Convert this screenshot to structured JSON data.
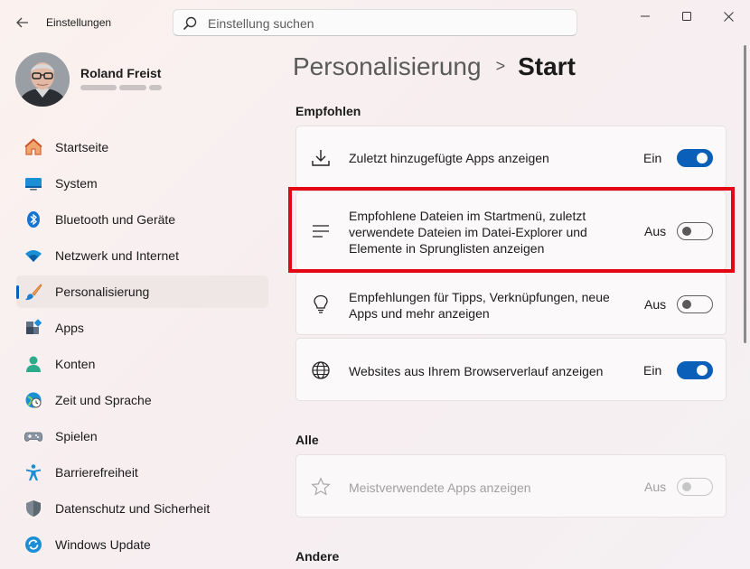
{
  "window": {
    "title": "Einstellungen"
  },
  "search": {
    "placeholder": "Einstellung suchen"
  },
  "user": {
    "name": "Roland Freist"
  },
  "nav": {
    "items": [
      {
        "label": "Startseite",
        "icon": "home-icon"
      },
      {
        "label": "System",
        "icon": "monitor-icon"
      },
      {
        "label": "Bluetooth und Geräte",
        "icon": "bluetooth-icon"
      },
      {
        "label": "Netzwerk und Internet",
        "icon": "wifi-icon"
      },
      {
        "label": "Personalisierung",
        "icon": "brush-icon",
        "selected": true
      },
      {
        "label": "Apps",
        "icon": "apps-icon"
      },
      {
        "label": "Konten",
        "icon": "account-icon"
      },
      {
        "label": "Zeit und Sprache",
        "icon": "clock-globe-icon"
      },
      {
        "label": "Spielen",
        "icon": "gamepad-icon"
      },
      {
        "label": "Barrierefreiheit",
        "icon": "accessibility-icon"
      },
      {
        "label": "Datenschutz und Sicherheit",
        "icon": "shield-icon"
      },
      {
        "label": "Windows Update",
        "icon": "update-icon"
      }
    ]
  },
  "breadcrumb": {
    "parent": "Personalisierung",
    "separator": ">",
    "current": "Start"
  },
  "sections": {
    "recommended": {
      "title": "Empfohlen",
      "items": [
        {
          "text": "Zuletzt hinzugefügte Apps anzeigen",
          "state": "Ein",
          "on": true,
          "icon": "download-icon"
        },
        {
          "text": "Empfohlene Dateien im Startmenü, zuletzt verwendete Dateien im Datei-Explorer und Elemente in Sprunglisten anzeigen",
          "state": "Aus",
          "on": false,
          "icon": "list-icon"
        },
        {
          "text": "Empfehlungen für Tipps, Verknüpfungen, neue Apps und mehr anzeigen",
          "state": "Aus",
          "on": false,
          "icon": "lightbulb-icon"
        },
        {
          "text": "Websites aus Ihrem Browserverlauf anzeigen",
          "state": "Ein",
          "on": true,
          "icon": "globe-icon"
        }
      ]
    },
    "all": {
      "title": "Alle",
      "items": [
        {
          "text": "Meistverwendete Apps anzeigen",
          "state": "Aus",
          "on": false,
          "disabled": true,
          "icon": "star-icon"
        }
      ]
    },
    "other": {
      "title": "Andere"
    }
  },
  "colors": {
    "accent": "#0a5fb8",
    "highlight": "#e30613"
  }
}
